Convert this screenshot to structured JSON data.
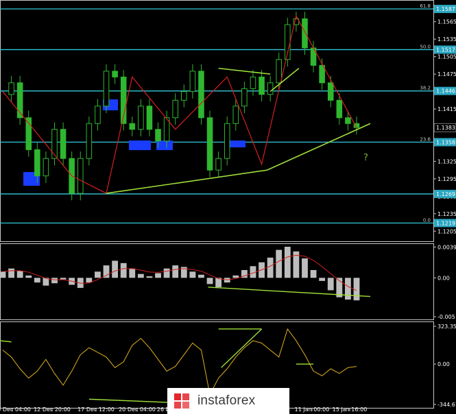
{
  "chart_data": [
    {
      "type": "candlestick",
      "symbol_pair": "EUR/USD",
      "ylim": [
        1.119,
        1.16
      ],
      "price_ticks": [
        "1.1565",
        "1.1535",
        "1.1505",
        "1.1475",
        "1.1445",
        "1.1415",
        "1.1385",
        "1.1355",
        "1.1325",
        "1.1295",
        "1.1265",
        "1.1235",
        "1.1205"
      ],
      "time_labels": [
        "10 Dec 04:00",
        "12 Dec 20:00",
        "17 Dec 12:00",
        "20 Dec 04:00",
        "26 Dec",
        "11 Jan 00:00",
        "15 Jan 16:00"
      ],
      "current_price": "1.1383",
      "fib_levels": [
        {
          "pct": "61.8",
          "price": "1.1587"
        },
        {
          "pct": "50.0",
          "price": "1.1517"
        },
        {
          "pct": "38.2",
          "price": "1.1446"
        },
        {
          "pct": "23.6",
          "price": "1.1358"
        },
        {
          "pct": "",
          "price": "1.1269"
        },
        {
          "pct": "0.0",
          "price": "1.1219"
        }
      ],
      "annotation": "?",
      "close_prices": [
        1.144,
        1.146,
        1.14,
        1.1345,
        1.13,
        1.133,
        1.138,
        1.133,
        1.127,
        1.133,
        1.139,
        1.142,
        1.148,
        1.147,
        1.139,
        1.138,
        1.142,
        1.138,
        1.136,
        1.14,
        1.143,
        1.1445,
        1.148,
        1.14,
        1.131,
        1.133,
        1.139,
        1.142,
        1.145,
        1.147,
        1.144,
        1.146,
        1.15,
        1.156,
        1.157,
        1.152,
        1.149,
        1.146,
        1.143,
        1.14,
        1.139,
        1.1383
      ]
    },
    {
      "type": "histogram",
      "indicator": "MACD",
      "ticks": [
        "0.00397",
        "0.00",
        "-0.005"
      ],
      "values": [
        0.0008,
        0.0012,
        0.0009,
        0.0003,
        -0.0006,
        -0.001,
        -0.0007,
        -0.0002,
        -0.0009,
        -0.0013,
        -0.0006,
        0.0008,
        0.0016,
        0.0022,
        0.0019,
        0.0012,
        0.0005,
        0.0002,
        0.0006,
        0.0012,
        0.0016,
        0.0014,
        0.0008,
        0.0004,
        -0.0008,
        -0.0012,
        -0.0006,
        0.0003,
        0.001,
        0.0015,
        0.002,
        0.0026,
        0.0036,
        0.004,
        0.0034,
        0.0025,
        0.001,
        -0.0004,
        -0.0016,
        -0.0025,
        -0.0028,
        -0.0029
      ]
    },
    {
      "type": "line",
      "indicator": "CCI",
      "ticks": [
        "323.3582",
        "0.00",
        "-344.6727"
      ],
      "values": [
        120,
        60,
        -40,
        -120,
        -60,
        40,
        -80,
        -180,
        -60,
        80,
        140,
        100,
        60,
        -30,
        20,
        160,
        220,
        140,
        40,
        -60,
        -20,
        80,
        180,
        120,
        -260,
        -120,
        -40,
        60,
        140,
        200,
        180,
        120,
        60,
        300,
        200,
        80,
        -60,
        -100,
        -40,
        -80,
        -30,
        -20
      ]
    }
  ]
}
